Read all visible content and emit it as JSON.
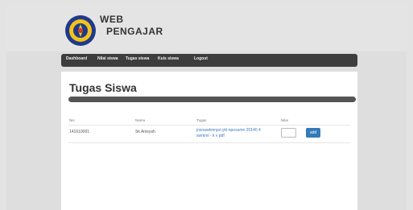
{
  "brand": {
    "line1": "WEB",
    "line2": "PENGAJAR"
  },
  "nav": {
    "items": [
      {
        "label": "Dashboard"
      },
      {
        "label": "Nilai siswa"
      },
      {
        "label": "Tugas siswa"
      },
      {
        "label": "Kuis siswa"
      },
      {
        "label": "Logout"
      }
    ]
  },
  "main": {
    "title": "Tugas Siswa",
    "progress_percent": 100,
    "table": {
      "headers": [
        "Nis",
        "Nama",
        "Tugas",
        "Nilai"
      ],
      "rows": [
        {
          "nis": "141610001",
          "nama": "Sk Anisyah",
          "tugas": "jnsnawkmnpz-ykl-nposumn 20146 4 swrkml - k v pdf",
          "nilai": "",
          "button": "add"
        }
      ]
    }
  },
  "colors": {
    "navbar": "#3d3d3d",
    "progress": "#555555",
    "link": "#3a7bc0",
    "button": "#337ab7"
  }
}
